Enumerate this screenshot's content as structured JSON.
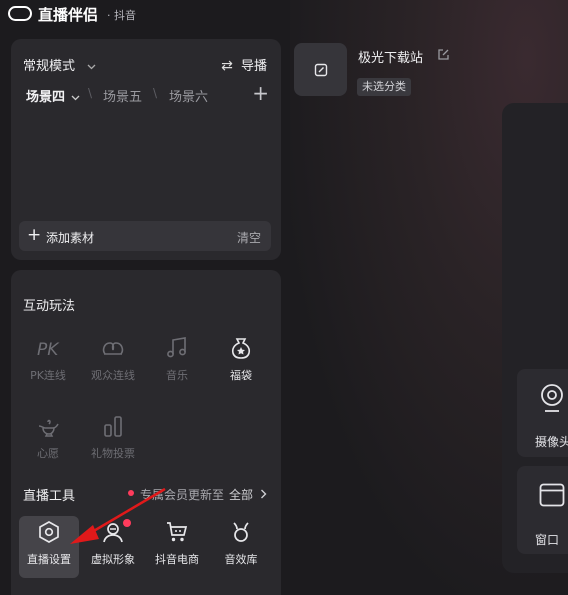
{
  "app": {
    "title": "直播伴侣",
    "subtitle": "· 抖音"
  },
  "scene_panel": {
    "mode": "常规模式",
    "guide": "导播",
    "scenes": [
      "场景四",
      "场景五",
      "场景六"
    ],
    "add_material": "添加素材",
    "clear": "清空"
  },
  "interaction": {
    "title": "互动玩法",
    "items": [
      {
        "label": "PK连线",
        "icon": "pk-icon"
      },
      {
        "label": "观众连线",
        "icon": "audience-link-icon"
      },
      {
        "label": "音乐",
        "icon": "music-icon"
      },
      {
        "label": "福袋",
        "icon": "lucky-bag-icon"
      },
      {
        "label": "心愿",
        "icon": "wish-lamp-icon"
      },
      {
        "label": "礼物投票",
        "icon": "gift-vote-icon"
      }
    ]
  },
  "live_tools": {
    "title": "直播工具",
    "vip_notice": "专属会员更新至",
    "all_link": "全部",
    "items": [
      {
        "label": "直播设置",
        "icon": "hexagon-settings-icon"
      },
      {
        "label": "虚拟形象",
        "icon": "avatar-icon"
      },
      {
        "label": "抖音电商",
        "icon": "cart-icon"
      },
      {
        "label": "音效库",
        "icon": "sound-effect-icon"
      }
    ]
  },
  "source": {
    "name": "极光下载站",
    "category": "未选分类"
  },
  "side_cards": [
    {
      "label": "摄像头",
      "icon": "camera-icon"
    },
    {
      "label": "窗口",
      "icon": "window-icon"
    }
  ],
  "colors": {
    "background": "#1c1b1e",
    "panel": "#2a292d",
    "accent_red": "#ff3b5c",
    "annotation_arrow": "#e0191a"
  }
}
